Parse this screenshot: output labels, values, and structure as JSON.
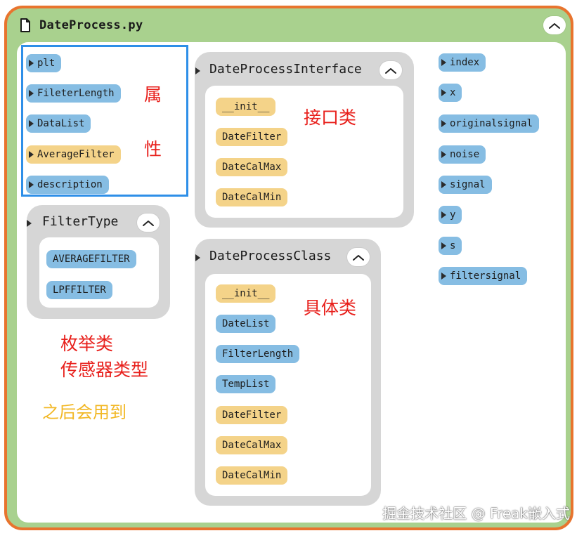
{
  "file": {
    "title": "DateProcess.py"
  },
  "attributes": [
    {
      "label": "plt",
      "color": "blue"
    },
    {
      "label": "FileterLength",
      "color": "blue"
    },
    {
      "label": "DataList",
      "color": "blue"
    },
    {
      "label": "AverageFilter",
      "color": "yellow"
    },
    {
      "label": "description",
      "color": "blue"
    }
  ],
  "filter_type": {
    "title": "FilterType",
    "items": [
      "AVERAGEFILTER",
      "LPFFILTER"
    ]
  },
  "interface": {
    "title": "DateProcessInterface",
    "items": [
      "__init__",
      "DateFilter",
      "DateCalMax",
      "DateCalMin"
    ]
  },
  "process_class": {
    "title": "DateProcessClass",
    "items": [
      "__init__",
      "DateList",
      "FilterLength",
      "TempList",
      "DateFilter",
      "DateCalMax",
      "DateCalMin"
    ]
  },
  "globals": [
    "index",
    "x",
    "originalsignal",
    "noise",
    "signal",
    "y",
    "s",
    "filtersignal"
  ],
  "annotations": {
    "attr_line1": "属",
    "attr_line2": "性",
    "interface": "接口类",
    "concrete": "具体类",
    "enum_line1": "枚举类",
    "enum_line2": "传感器类型",
    "later": "之后会用到"
  },
  "watermark": "掘金技术社区 @ Freak嵌入式",
  "colors": {
    "frame_border": "#e8742e",
    "frame_fill": "#a9d18e",
    "method_pill": "#f4d389",
    "attr_pill": "#86bde3",
    "annotation_red": "#e8201c",
    "annotation_gold": "#f2b826",
    "selection_blue": "#2e8fe8"
  },
  "icons": {
    "file": "file-icon",
    "collapse": "chevron-up-icon",
    "expand_marker": "triangle-right-icon"
  }
}
